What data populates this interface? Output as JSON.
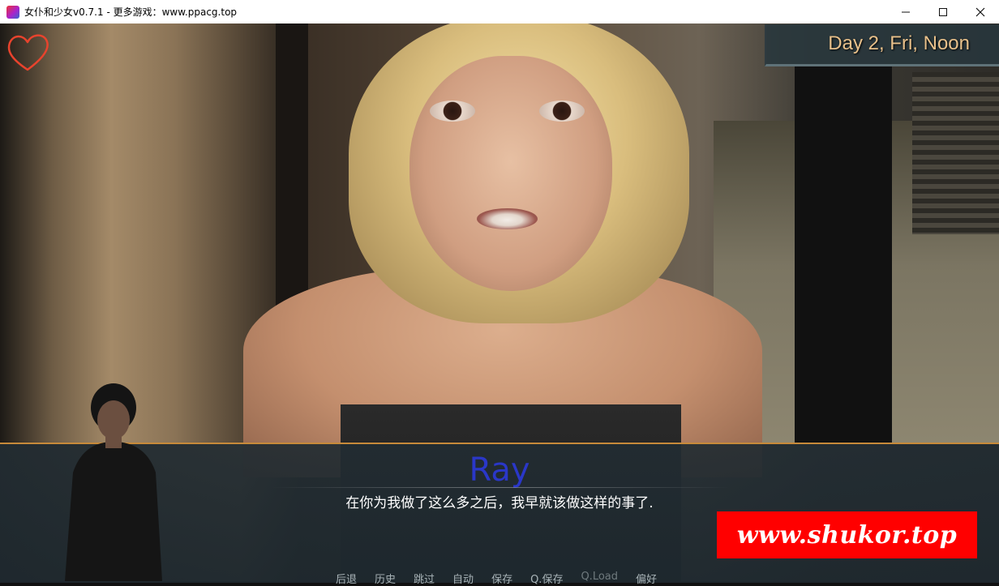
{
  "window": {
    "title": "女仆和少女v0.7.1 - 更多游戏：www.ppacg.top",
    "minimize_glyph": "—",
    "maximize_glyph": "☐",
    "close_glyph": "✕"
  },
  "hud": {
    "date_time": "Day 2, Fri, Noon",
    "affection_icon": "heart-outline-icon",
    "heart_color": "#e8432d"
  },
  "dialogue": {
    "speaker": "Ray",
    "speaker_color": "#2a37c8",
    "text": "在你为我做了这么多之后，我早就该做这样的事了."
  },
  "quick_menu": {
    "items": [
      "后退",
      "历史",
      "跳过",
      "自动",
      "保存",
      "Q.保存",
      "Q.Load",
      "偏好"
    ]
  },
  "watermark": {
    "text": "www.shukor.top",
    "color": "#ff0000"
  },
  "colors": {
    "accent_border": "#c78a3a",
    "date_text": "#e8c08a"
  }
}
